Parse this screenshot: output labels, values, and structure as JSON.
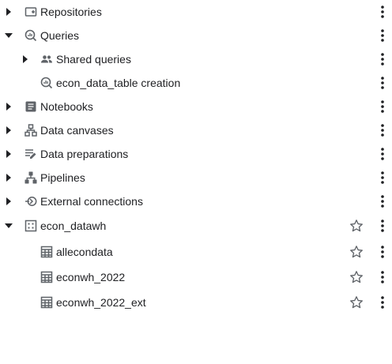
{
  "tree": {
    "repositories": {
      "label": "Repositories",
      "icon": "repository-icon",
      "expanded": false
    },
    "queries": {
      "label": "Queries",
      "icon": "query-icon",
      "expanded": true
    },
    "shared_queries": {
      "label": "Shared queries",
      "icon": "people-icon",
      "expanded": false
    },
    "econ_query": {
      "label": "econ_data_table creation",
      "icon": "query-icon"
    },
    "notebooks": {
      "label": "Notebooks",
      "icon": "notebook-icon",
      "expanded": false
    },
    "data_canvases": {
      "label": "Data canvases",
      "icon": "canvas-icon",
      "expanded": false
    },
    "data_preparations": {
      "label": "Data preparations",
      "icon": "data-prep-icon",
      "expanded": false
    },
    "pipelines": {
      "label": "Pipelines",
      "icon": "pipeline-icon",
      "expanded": false
    },
    "external_connections": {
      "label": "External connections",
      "icon": "connection-icon",
      "expanded": false
    },
    "dataset": {
      "label": "econ_datawh",
      "icon": "dataset-icon",
      "expanded": true
    },
    "tables": [
      {
        "label": "allecondata",
        "icon": "table-icon"
      },
      {
        "label": "econwh_2022",
        "icon": "table-icon"
      },
      {
        "label": "econwh_2022_ext",
        "icon": "table-icon"
      }
    ]
  },
  "colors": {
    "text": "#202124",
    "icon": "#5f6368",
    "arrow": "#202124"
  }
}
